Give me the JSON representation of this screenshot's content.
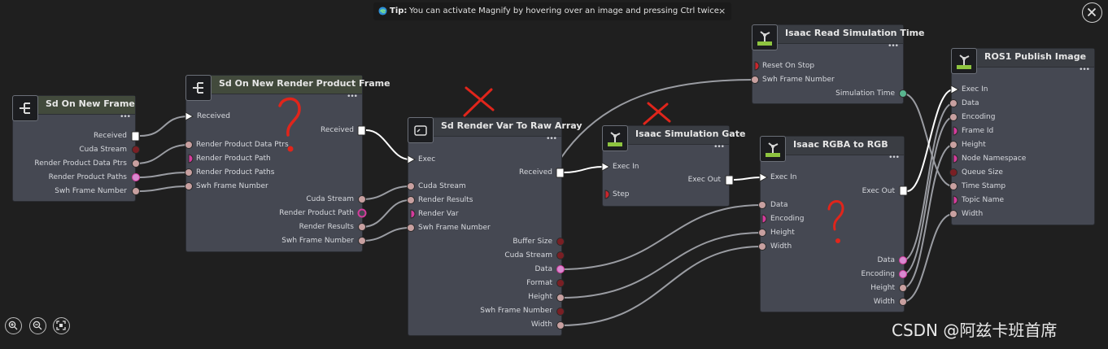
{
  "tip": {
    "label": "Tip:",
    "text": "You can activate Magnify by hovering over an image and pressing Ctrl twice.",
    "close": "×"
  },
  "nodes": {
    "sd_new_frame": {
      "title": "Sd On New Frame",
      "outputs": [
        "Received",
        "Cuda Stream",
        "Render Product Data Ptrs",
        "Render Product Paths",
        "Swh Frame Number"
      ]
    },
    "sd_render_product_frame": {
      "title": "Sd On New Render Product Frame",
      "inputs": [
        "Received",
        "Render Product Data Ptrs",
        "Render Product Path",
        "Render Product Paths",
        "Swh Frame Number"
      ],
      "outputs": [
        "Received",
        "Cuda Stream",
        "Render Product Path",
        "Render Results",
        "Swh Frame Number"
      ]
    },
    "render_var_raw": {
      "title": "Sd Render Var To Raw Array",
      "inputs": [
        "Exec",
        "Cuda Stream",
        "Render Results",
        "Render Var",
        "Swh Frame Number"
      ],
      "outputs": [
        "Received",
        "Buffer Size",
        "Cuda Stream",
        "Data",
        "Format",
        "Height",
        "Swh Frame Number",
        "Width"
      ]
    },
    "sim_gate": {
      "title": "Isaac Simulation Gate",
      "inputs": [
        "Exec In",
        "Step"
      ],
      "outputs": [
        "Exec Out"
      ]
    },
    "read_sim_time": {
      "title": "Isaac Read Simulation Time",
      "inputs": [
        "Reset On Stop",
        "Swh Frame Number"
      ],
      "outputs": [
        "Simulation Time"
      ]
    },
    "rgba_to_rgb": {
      "title": "Isaac RGBA to RGB",
      "inputs": [
        "Exec In",
        "Data",
        "Encoding",
        "Height",
        "Width"
      ],
      "outputs": [
        "Exec Out",
        "Data",
        "Encoding",
        "Height",
        "Width"
      ]
    },
    "ros1_publish": {
      "title": "ROS1 Publish Image",
      "inputs": [
        "Exec In",
        "Data",
        "Encoding",
        "Frame Id",
        "Height",
        "Node Namespace",
        "Queue Size",
        "Time Stamp",
        "Topic Name",
        "Width"
      ]
    }
  },
  "menu_dots": "•••",
  "watermark": "CSDN @阿兹卡班首席",
  "colors": {
    "background": "#1f1f1f",
    "node_body": "#454852",
    "wire": "#9a9ca2",
    "annotation_red": "#e0251b",
    "pin_pink": "#d43c9c",
    "pin_red": "#c9252d",
    "pin_dark_red": "#7a1f24",
    "pin_teal": "#59b58f"
  }
}
